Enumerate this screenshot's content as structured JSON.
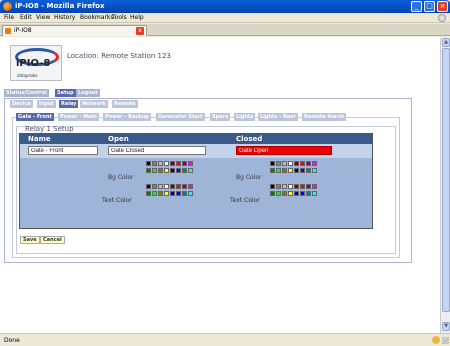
{
  "window": {
    "title": "iP-IO8 - Mozilla Firefox",
    "min_label": "_",
    "max_label": "□",
    "close_label": "×"
  },
  "menu": [
    {
      "label": "File",
      "key": "menu-file"
    },
    {
      "label": "Edit",
      "key": "menu-edit"
    },
    {
      "label": "View",
      "key": "menu-view"
    },
    {
      "label": "History",
      "key": "menu-history"
    },
    {
      "label": "Bookmarks",
      "key": "menu-bookmarks"
    },
    {
      "label": "Tools",
      "key": "menu-tools"
    },
    {
      "label": "Help",
      "key": "menu-help"
    }
  ],
  "browser_tab": {
    "label": "iP-IO8",
    "close_label": "x"
  },
  "logo": {
    "text": "iPIO-8",
    "subtext": "dataprobe"
  },
  "location": {
    "label": "Location: Remote Station 123"
  },
  "nav": [
    "Status/Control",
    "Setup",
    "Logout"
  ],
  "setup_tabs": [
    "Device",
    "Input",
    "Relay",
    "Network",
    "Remote"
  ],
  "relay_tabs": [
    "Gate - Front",
    "Power - Main",
    "Power - Backup",
    "Generator Start",
    "Spare",
    "Lights",
    "Lights - Rear",
    "Remote Alarm"
  ],
  "relay": {
    "title": "Relay 1 Setup",
    "col_name": "Name",
    "col_open": "Open",
    "col_closed": "Closed",
    "name_value": "Gate - Front",
    "open_value": "Gate Closed",
    "closed_value": "Gate Open",
    "bg_color_label": "Bg Color",
    "text_color_label": "Text Color"
  },
  "palette_colors": [
    "#000000",
    "#7f7f7f",
    "#c0c0c0",
    "#ffffff",
    "#800000",
    "#ff0000",
    "#800080",
    "#ff00ff",
    "#008000",
    "#00ff00",
    "#808000",
    "#ffff00",
    "#000080",
    "#0000ff",
    "#008080",
    "#00ffff"
  ],
  "colors": {
    "closed_bg": "#ee0000",
    "header_bg": "#3a5a8a",
    "active_tab": "#5a6aa8"
  },
  "actions": {
    "save": "Save",
    "cancel": "Cancel"
  },
  "status": {
    "text": "Done"
  }
}
